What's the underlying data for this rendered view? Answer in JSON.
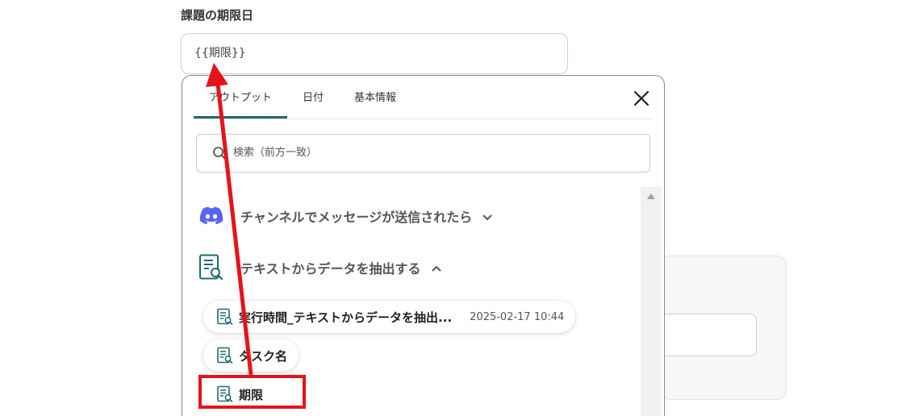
{
  "field": {
    "label": "課題の期限日",
    "value": "{{期限}}"
  },
  "popup": {
    "tabs": [
      {
        "label": "アウトプット",
        "active": true
      },
      {
        "label": "日付",
        "active": false
      },
      {
        "label": "基本情報",
        "active": false
      }
    ],
    "close_icon": "close-icon",
    "search": {
      "placeholder": "検索（前方一致）",
      "icon": "search-icon"
    },
    "groups": [
      {
        "title": "チャンネルでメッセージが送信されたら",
        "icon": "discord-icon",
        "expanded": false
      },
      {
        "title": "テキストからデータを抽出する",
        "icon": "document-search-icon",
        "expanded": true
      }
    ],
    "items": [
      {
        "name": "実行時間_テキストからデータを抽出...",
        "value": "2025-02-17 10:44"
      },
      {
        "name": "タスク名",
        "value": ""
      },
      {
        "name": "期限",
        "value": ""
      }
    ]
  },
  "colors": {
    "tab_accent": "#1f6874",
    "annotation_red": "#e4141b",
    "discord_blurple": "#5865f2"
  }
}
